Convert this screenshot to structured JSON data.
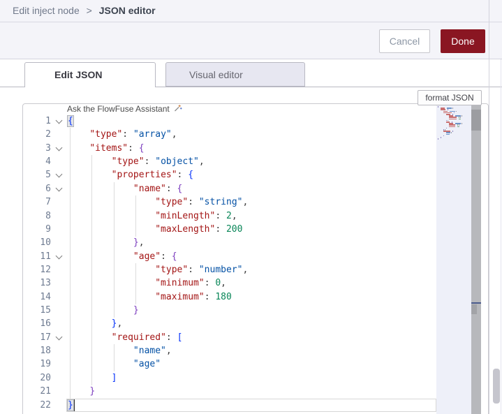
{
  "header": {
    "breadcrumb_section": "Edit inject node",
    "breadcrumb_separator": ">",
    "breadcrumb_page": "JSON editor"
  },
  "toolbar": {
    "cancel_label": "Cancel",
    "done_label": "Done"
  },
  "tabs": [
    {
      "label": "Edit JSON",
      "active": true
    },
    {
      "label": "Visual editor",
      "active": false
    }
  ],
  "format_button_label": "format JSON",
  "assistant_hint": "Ask the FlowFuse Assistant",
  "icons": {
    "fold_chevron": "chevron-down-icon",
    "assistant": "sparkle-wand-icon"
  },
  "colors": {
    "done_button_bg": "#8a1622",
    "header_bg": "#f4f4f9",
    "inactive_tab_bg": "#e7e7f1",
    "token_key": "#a31515",
    "token_string": "#0451a5",
    "token_number": "#098658",
    "bracket_blue": "#0431fa",
    "bracket_purple": "#7b3cbe",
    "minimap_bg": "#eef0f9",
    "scroll_track": "#b7b8bc"
  },
  "editor": {
    "language": "json",
    "line_count": 22,
    "active_line": 22,
    "cursor": {
      "line": 22,
      "column": 2
    },
    "folded_lines": [
      1,
      3,
      5,
      6,
      11,
      17
    ],
    "lines": [
      {
        "n": 1,
        "ind": 0,
        "fold": true,
        "tokens": [
          [
            "b1m",
            "{"
          ]
        ]
      },
      {
        "n": 2,
        "ind": 4,
        "fold": false,
        "tokens": [
          [
            "key",
            "\"type\""
          ],
          [
            "pn",
            ": "
          ],
          [
            "str",
            "\"array\""
          ],
          [
            "pn",
            ","
          ]
        ]
      },
      {
        "n": 3,
        "ind": 4,
        "fold": true,
        "tokens": [
          [
            "key",
            "\"items\""
          ],
          [
            "pn",
            ": "
          ],
          [
            "b2",
            "{"
          ]
        ]
      },
      {
        "n": 4,
        "ind": 8,
        "fold": false,
        "tokens": [
          [
            "key",
            "\"type\""
          ],
          [
            "pn",
            ": "
          ],
          [
            "str",
            "\"object\""
          ],
          [
            "pn",
            ","
          ]
        ]
      },
      {
        "n": 5,
        "ind": 8,
        "fold": true,
        "tokens": [
          [
            "key",
            "\"properties\""
          ],
          [
            "pn",
            ": "
          ],
          [
            "b3",
            "{"
          ]
        ]
      },
      {
        "n": 6,
        "ind": 12,
        "fold": true,
        "tokens": [
          [
            "key",
            "\"name\""
          ],
          [
            "pn",
            ": "
          ],
          [
            "b4",
            "{"
          ]
        ]
      },
      {
        "n": 7,
        "ind": 16,
        "fold": false,
        "tokens": [
          [
            "key",
            "\"type\""
          ],
          [
            "pn",
            ": "
          ],
          [
            "str",
            "\"string\""
          ],
          [
            "pn",
            ","
          ]
        ]
      },
      {
        "n": 8,
        "ind": 16,
        "fold": false,
        "tokens": [
          [
            "key",
            "\"minLength\""
          ],
          [
            "pn",
            ": "
          ],
          [
            "num",
            "2"
          ],
          [
            "pn",
            ","
          ]
        ]
      },
      {
        "n": 9,
        "ind": 16,
        "fold": false,
        "tokens": [
          [
            "key",
            "\"maxLength\""
          ],
          [
            "pn",
            ": "
          ],
          [
            "num",
            "200"
          ]
        ]
      },
      {
        "n": 10,
        "ind": 12,
        "fold": false,
        "tokens": [
          [
            "b4",
            "}"
          ],
          [
            "pn",
            ","
          ]
        ]
      },
      {
        "n": 11,
        "ind": 12,
        "fold": true,
        "tokens": [
          [
            "key",
            "\"age\""
          ],
          [
            "pn",
            ": "
          ],
          [
            "b4",
            "{"
          ]
        ]
      },
      {
        "n": 12,
        "ind": 16,
        "fold": false,
        "tokens": [
          [
            "key",
            "\"type\""
          ],
          [
            "pn",
            ": "
          ],
          [
            "str",
            "\"number\""
          ],
          [
            "pn",
            ","
          ]
        ]
      },
      {
        "n": 13,
        "ind": 16,
        "fold": false,
        "tokens": [
          [
            "key",
            "\"minimum\""
          ],
          [
            "pn",
            ": "
          ],
          [
            "num",
            "0"
          ],
          [
            "pn",
            ","
          ]
        ]
      },
      {
        "n": 14,
        "ind": 16,
        "fold": false,
        "tokens": [
          [
            "key",
            "\"maximum\""
          ],
          [
            "pn",
            ": "
          ],
          [
            "num",
            "180"
          ]
        ]
      },
      {
        "n": 15,
        "ind": 12,
        "fold": false,
        "tokens": [
          [
            "b4",
            "}"
          ]
        ]
      },
      {
        "n": 16,
        "ind": 8,
        "fold": false,
        "tokens": [
          [
            "b3",
            "}"
          ],
          [
            "pn",
            ","
          ]
        ]
      },
      {
        "n": 17,
        "ind": 8,
        "fold": true,
        "tokens": [
          [
            "key",
            "\"required\""
          ],
          [
            "pn",
            ": "
          ],
          [
            "b3",
            "["
          ]
        ]
      },
      {
        "n": 18,
        "ind": 12,
        "fold": false,
        "tokens": [
          [
            "str",
            "\"name\""
          ],
          [
            "pn",
            ","
          ]
        ]
      },
      {
        "n": 19,
        "ind": 12,
        "fold": false,
        "tokens": [
          [
            "str",
            "\"age\""
          ]
        ]
      },
      {
        "n": 20,
        "ind": 8,
        "fold": false,
        "tokens": [
          [
            "b3",
            "]"
          ]
        ]
      },
      {
        "n": 21,
        "ind": 4,
        "fold": false,
        "tokens": [
          [
            "b2",
            "}"
          ]
        ]
      },
      {
        "n": 22,
        "ind": 0,
        "fold": false,
        "tokens": [
          [
            "b1m",
            "}"
          ]
        ]
      }
    ]
  }
}
